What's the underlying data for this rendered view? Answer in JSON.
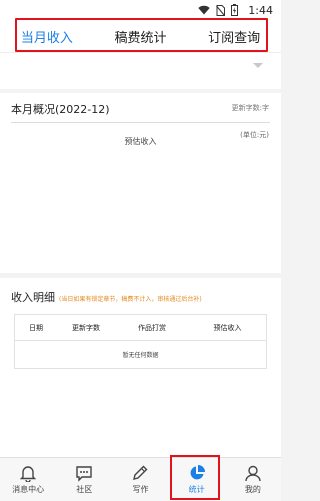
{
  "status_bar": {
    "time": "1:44"
  },
  "tabs": [
    {
      "label": "当月收入",
      "active": true
    },
    {
      "label": "稿费统计",
      "active": false
    },
    {
      "label": "订阅查询",
      "active": false
    }
  ],
  "overview": {
    "title": "本月概况(2022-12)",
    "meta": "更新字数:字",
    "unit": "(单位:元)",
    "estimated_label": "预估收入"
  },
  "detail": {
    "title": "收入明细",
    "note": "(当日如果有锁定章节，稿费不计入，审核通过后台补)",
    "columns": [
      "日期",
      "更新字数",
      "作品打赏",
      "预估收入"
    ],
    "empty_text": "暂无任何数据"
  },
  "bottom_nav": [
    {
      "label": "消息中心",
      "icon": "bell-icon",
      "active": false
    },
    {
      "label": "社区",
      "icon": "chat-icon",
      "active": false
    },
    {
      "label": "写作",
      "icon": "pen-icon",
      "active": false
    },
    {
      "label": "统计",
      "icon": "pie-chart-icon",
      "active": true
    },
    {
      "label": "我的",
      "icon": "user-icon",
      "active": false
    }
  ],
  "colors": {
    "accent": "#1b7fe6",
    "highlight": "#e2141b",
    "note": "#e58a1a"
  }
}
